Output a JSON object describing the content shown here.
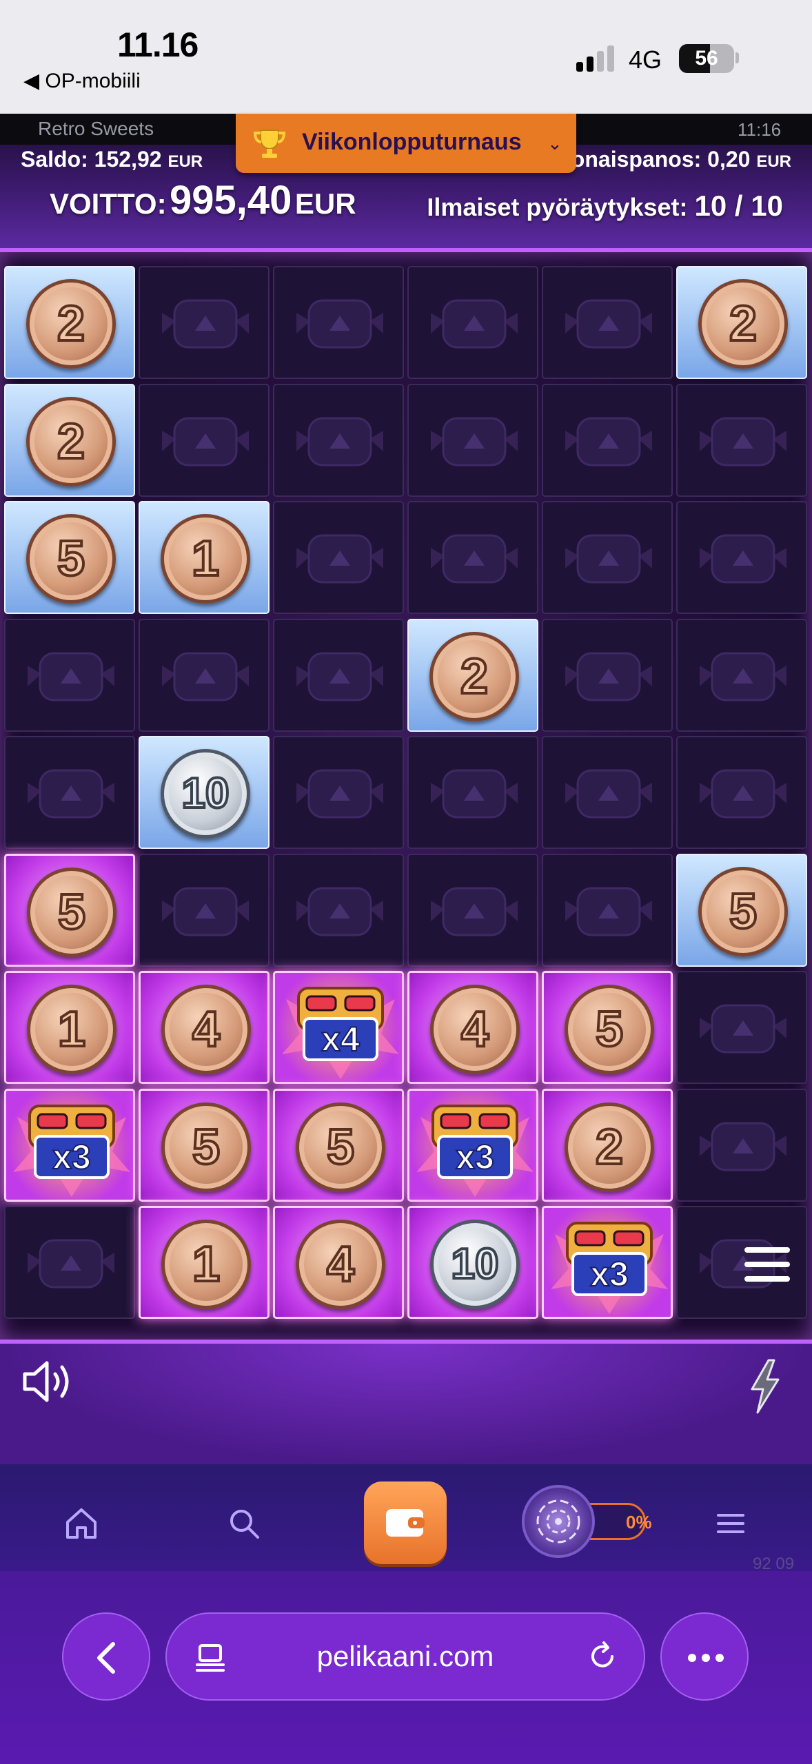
{
  "status_bar": {
    "time": "11.16",
    "back_app": "◀ OP-mobiili",
    "network": "4G",
    "battery": "56",
    "battery_level": 0.56
  },
  "game": {
    "name": "Retro Sweets",
    "clock": "11:16",
    "balance_label": "Saldo:",
    "balance_value": "152,92",
    "currency": "EUR",
    "tournament_label": "Viikonlopputurnaus",
    "total_bet_label": "Kokonaispanos:",
    "total_bet_value": "0,20",
    "win_label": "VOITTO:",
    "win_value": "995,40",
    "freespins_label": "Ilmaiset pyöräytykset:",
    "freespins_value": "10 / 10"
  },
  "grid": {
    "rows": [
      [
        {
          "t": "coin",
          "v": "2",
          "s": "bronze"
        },
        {
          "t": "empty"
        },
        {
          "t": "empty"
        },
        {
          "t": "empty"
        },
        {
          "t": "empty"
        },
        {
          "t": "coin",
          "v": "2",
          "s": "bronze"
        }
      ],
      [
        {
          "t": "coin",
          "v": "2",
          "s": "bronze"
        },
        {
          "t": "empty"
        },
        {
          "t": "empty"
        },
        {
          "t": "empty"
        },
        {
          "t": "empty"
        },
        {
          "t": "empty"
        }
      ],
      [
        {
          "t": "coin",
          "v": "5",
          "s": "bronze"
        },
        {
          "t": "coin",
          "v": "1",
          "s": "bronze"
        },
        {
          "t": "empty"
        },
        {
          "t": "empty"
        },
        {
          "t": "empty"
        },
        {
          "t": "empty"
        }
      ],
      [
        {
          "t": "empty"
        },
        {
          "t": "empty"
        },
        {
          "t": "empty"
        },
        {
          "t": "coin",
          "v": "2",
          "s": "bronze"
        },
        {
          "t": "empty"
        },
        {
          "t": "empty"
        }
      ],
      [
        {
          "t": "empty"
        },
        {
          "t": "coin",
          "v": "10",
          "s": "silver"
        },
        {
          "t": "empty"
        },
        {
          "t": "empty"
        },
        {
          "t": "empty"
        },
        {
          "t": "empty"
        }
      ],
      [
        {
          "t": "coin",
          "v": "5",
          "s": "bronze",
          "glow": true
        },
        {
          "t": "empty"
        },
        {
          "t": "empty"
        },
        {
          "t": "empty"
        },
        {
          "t": "empty"
        },
        {
          "t": "coin",
          "v": "5",
          "s": "bronze"
        }
      ],
      [
        {
          "t": "coin",
          "v": "1",
          "s": "bronze",
          "glow": true
        },
        {
          "t": "coin",
          "v": "4",
          "s": "bronze",
          "glow": true
        },
        {
          "t": "mult",
          "v": "x4"
        },
        {
          "t": "coin",
          "v": "4",
          "s": "bronze",
          "glow": true
        },
        {
          "t": "coin",
          "v": "5",
          "s": "bronze",
          "glow": true
        },
        {
          "t": "empty"
        }
      ],
      [
        {
          "t": "mult",
          "v": "x3"
        },
        {
          "t": "coin",
          "v": "5",
          "s": "bronze",
          "glow": true
        },
        {
          "t": "coin",
          "v": "5",
          "s": "bronze",
          "glow": true
        },
        {
          "t": "mult",
          "v": "x3"
        },
        {
          "t": "coin",
          "v": "2",
          "s": "bronze",
          "glow": true
        },
        {
          "t": "empty"
        }
      ],
      [
        {
          "t": "empty"
        },
        {
          "t": "coin",
          "v": "1",
          "s": "bronze",
          "glow": true
        },
        {
          "t": "coin",
          "v": "4",
          "s": "bronze",
          "glow": true
        },
        {
          "t": "coin",
          "v": "10",
          "s": "silver",
          "glow": true
        },
        {
          "t": "mult",
          "v": "x3"
        },
        {
          "t": "empty"
        }
      ]
    ]
  },
  "site_nav": {
    "wheel_percent": "0%",
    "version": "92 09",
    "icons": [
      "home-icon",
      "search-icon",
      "wallet-icon",
      "wheel-icon",
      "menu-icon"
    ]
  },
  "browser": {
    "url": "pelikaani.com"
  },
  "colors": {
    "accent_orange": "#e87a23",
    "grid_glow": "#c060ff"
  }
}
